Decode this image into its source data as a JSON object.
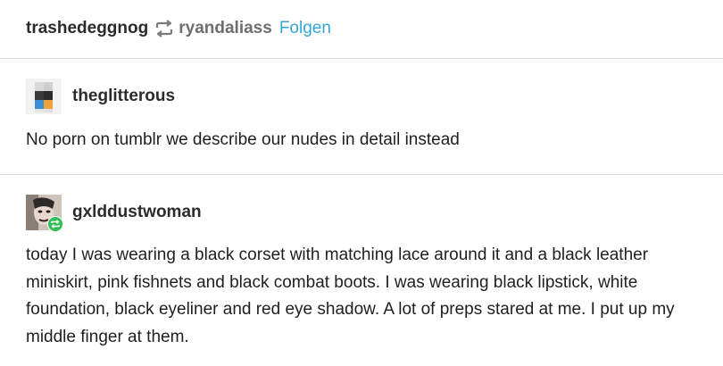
{
  "header": {
    "blog_name": "trashedeggnog",
    "reblog_icon": "reblog-arrows-icon",
    "reblogged_from": "ryandaliass",
    "follow_label": "Folgen"
  },
  "entries": [
    {
      "username": "theglitterous",
      "avatar_icon": "pixel-avatar",
      "text": "No porn on tumblr we describe our nudes in detail instead"
    },
    {
      "username": "gxlddustwoman",
      "avatar_icon": "photo-avatar",
      "badge_icon": "reblog-badge-icon",
      "text": "today I was wearing a black corset with matching lace around it and a black leather miniskirt, pink fishnets and black combat boots. I was wearing black lipstick, white foundation, black eyeliner and red eye shadow. A lot of preps stared at me. I put up my middle finger at them."
    }
  ],
  "colors": {
    "follow_link": "#36a6d8",
    "divider": "#d9d9d9",
    "reblog_badge": "#2fbf55"
  }
}
